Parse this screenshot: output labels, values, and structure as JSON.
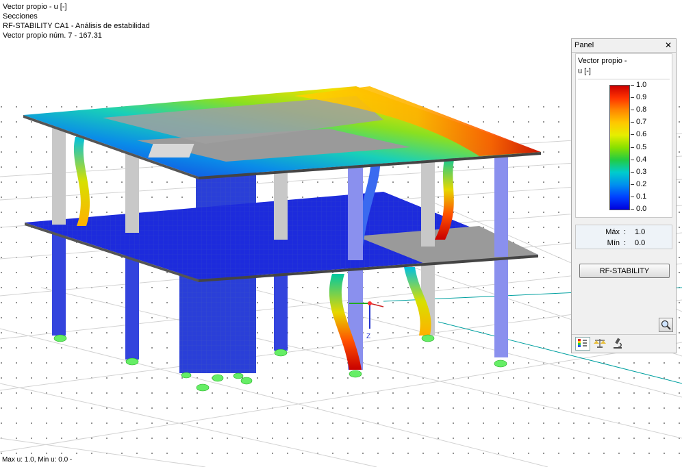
{
  "info": {
    "line1": "Vector propio - u [-]",
    "line2": "Secciones",
    "line3": "RF-STABILITY CA1 - Análisis de estabilidad",
    "line4": "Vector propio núm. 7  -  167.31"
  },
  "status_bar": "Max u: 1.0, Min u: 0.0 -",
  "axis_label": "Z",
  "panel": {
    "title": "Panel",
    "close_icon": "close-icon",
    "result_label_1": "Vector propio -",
    "result_label_2": "u [-]",
    "legend": {
      "values": [
        "1.0",
        "0.9",
        "0.8",
        "0.7",
        "0.6",
        "0.5",
        "0.4",
        "0.3",
        "0.2",
        "0.1",
        "0.0"
      ],
      "colors": [
        "#cc0000",
        "#ff3300",
        "#ff8800",
        "#ffc800",
        "#e6ee00",
        "#88e000",
        "#22cc44",
        "#00cccc",
        "#0090ee",
        "#0040ff",
        "#0000dd"
      ]
    },
    "max_label": "Máx",
    "max_value": "1.0",
    "min_label": "Mín",
    "min_value": "0.0",
    "button": "RF-STABILITY",
    "tabs": [
      "color-scale-icon",
      "balance-icon",
      "microscope-icon"
    ]
  }
}
